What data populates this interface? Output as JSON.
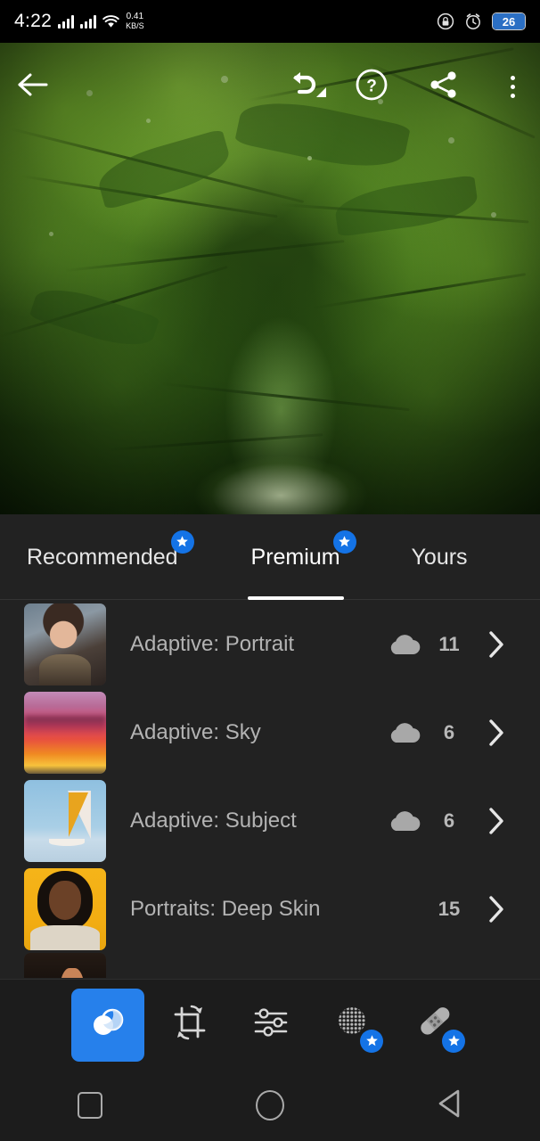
{
  "status_bar": {
    "time": "4:22",
    "network_speed_value": "0.41",
    "network_speed_unit": "KB/S",
    "signal_icon": "signal-bars-icon",
    "wifi_icon": "wifi-icon",
    "rotation_lock_icon": "rotation-lock-icon",
    "alarm_icon": "alarm-clock-icon",
    "battery_percent": "26",
    "battery_fill_color": "#2b6fc4"
  },
  "top_toolbar": {
    "back_icon": "back-arrow-icon",
    "undo_icon": "undo-icon",
    "help_icon": "help-circle-icon",
    "share_icon": "share-icon",
    "more_icon": "more-vertical-icon"
  },
  "presets_panel": {
    "tabs": [
      {
        "label": "Recommended",
        "premium_badge": true,
        "active": false
      },
      {
        "label": "Premium",
        "premium_badge": true,
        "active": true
      },
      {
        "label": "Yours",
        "premium_badge": false,
        "active": false
      }
    ],
    "badge_color": "#1473e6",
    "rows": [
      {
        "title": "Adaptive: Portrait",
        "cloud_icon": "cloud-icon",
        "has_cloud": true,
        "count": "11",
        "chevron_icon": "chevron-right-icon",
        "thumb": "portrait-thumbnail"
      },
      {
        "title": "Adaptive: Sky",
        "cloud_icon": "cloud-icon",
        "has_cloud": true,
        "count": "6",
        "chevron_icon": "chevron-right-icon",
        "thumb": "sunset-sky-thumbnail"
      },
      {
        "title": "Adaptive: Subject",
        "cloud_icon": "cloud-icon",
        "has_cloud": true,
        "count": "6",
        "chevron_icon": "chevron-right-icon",
        "thumb": "sailboat-thumbnail"
      },
      {
        "title": "Portraits: Deep Skin",
        "cloud_icon": "cloud-icon",
        "has_cloud": false,
        "count": "15",
        "chevron_icon": "chevron-right-icon",
        "thumb": "deep-skin-portrait-thumbnail"
      }
    ]
  },
  "bottom_toolbar": {
    "active_color": "#2680eb",
    "badge_color": "#1473e6",
    "tools": [
      {
        "name": "presets-tool",
        "icon": "presets-icon",
        "active": true,
        "premium_badge": false
      },
      {
        "name": "crop-tool",
        "icon": "crop-rotate-icon",
        "active": false,
        "premium_badge": false
      },
      {
        "name": "adjustments-tool",
        "icon": "sliders-icon",
        "active": false,
        "premium_badge": false
      },
      {
        "name": "masking-tool",
        "icon": "masking-dots-icon",
        "active": false,
        "premium_badge": true
      },
      {
        "name": "healing-tool",
        "icon": "healing-brush-icon",
        "active": false,
        "premium_badge": true
      }
    ]
  },
  "nav_bar": {
    "recents_icon": "recents-square-icon",
    "home_icon": "home-circle-icon",
    "back_icon": "back-triangle-icon"
  }
}
